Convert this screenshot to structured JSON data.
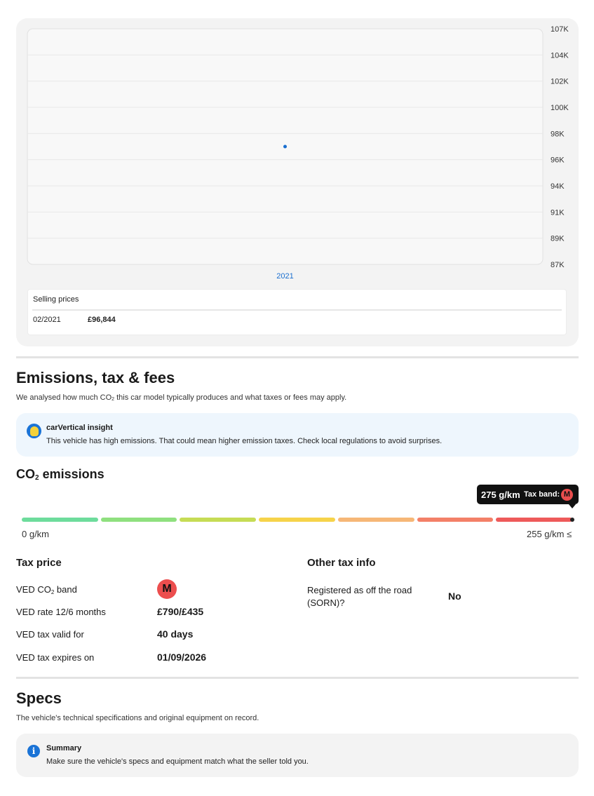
{
  "chart_data": {
    "type": "scatter",
    "x_categories": [
      "2021"
    ],
    "points": [
      {
        "x": "2021",
        "y": 96844
      }
    ],
    "y_ticks": [
      "107K",
      "104K",
      "102K",
      "100K",
      "98K",
      "96K",
      "94K",
      "91K",
      "89K",
      "87K"
    ],
    "ylim": [
      86844,
      106844
    ],
    "grid": true,
    "series_color": "#1a6fd0"
  },
  "selling_prices": {
    "title": "Selling prices",
    "rows": [
      {
        "date": "02/2021",
        "price": "£96,844"
      }
    ]
  },
  "emissions": {
    "heading": "Emissions, tax & fees",
    "subtitle_before": "We analysed how much CO",
    "subtitle_sub": "2",
    "subtitle_after": " this car model typically produces and what taxes or fees may apply.",
    "insight": {
      "title": "carVertical insight",
      "text": "This vehicle has high emissions. That could mean higher emission taxes. Check local regulations to avoid surprises."
    },
    "co2": {
      "heading_prefix": "CO",
      "heading_sub": "2",
      "heading_suffix": " emissions",
      "value_label": "275 g/km",
      "tax_band_label": "Tax band:",
      "tax_band": "M",
      "min_label": "0 g/km",
      "max_label": "255 g/km ≤",
      "segment_colors": [
        "#6ddc9c",
        "#8fe07f",
        "#c6dc55",
        "#f6d34a",
        "#f6b777",
        "#f38068",
        "#ee5a5a"
      ]
    }
  },
  "tax_price": {
    "heading": "Tax price",
    "rows": [
      {
        "label_prefix": "VED CO",
        "label_sub": "2",
        "label_suffix": " band",
        "value": "M",
        "badge": true
      },
      {
        "label": "VED rate 12/6 months",
        "value": "£790/£435"
      },
      {
        "label": "VED tax valid for",
        "value": "40 days"
      },
      {
        "label": "VED tax expires on",
        "value": "01/09/2026"
      }
    ]
  },
  "other_tax": {
    "heading": "Other tax info",
    "rows": [
      {
        "label_line1": "Registered as off the road",
        "label_line2": "(SORN)?",
        "value": "No"
      }
    ]
  },
  "specs": {
    "heading": "Specs",
    "subtitle": "The vehicle's technical specifications and original equipment on record.",
    "summary": {
      "icon": "i",
      "title": "Summary",
      "text": "Make sure the vehicle's specs and equipment match what the seller told you."
    }
  }
}
